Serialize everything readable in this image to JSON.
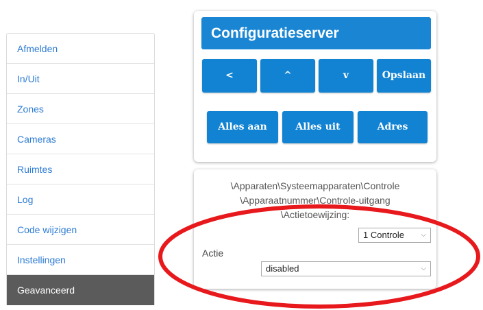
{
  "sidebar": {
    "items": [
      {
        "label": "Afmelden"
      },
      {
        "label": "In/Uit"
      },
      {
        "label": "Zones"
      },
      {
        "label": "Cameras"
      },
      {
        "label": "Ruimtes"
      },
      {
        "label": "Log"
      },
      {
        "label": "Code wijzigen"
      },
      {
        "label": "Instellingen"
      },
      {
        "label": "Geavanceerd"
      }
    ]
  },
  "header": {
    "title": "Configuratieserver"
  },
  "nav_buttons": {
    "back": "<",
    "up": "^",
    "down": "v",
    "save": "Opslaan"
  },
  "action_buttons": {
    "all_on": "Alles aan",
    "all_off": "Alles uit",
    "address": "Adres"
  },
  "config": {
    "path_line1": "\\Apparaten\\Systeemapparaten\\Controle",
    "path_line2": "\\Apparaatnummer\\Controle-uitgang",
    "path_line3": "\\Actietoewijzing:",
    "control_select": "1 Controle",
    "action_label": "Actie",
    "action_select": "disabled"
  },
  "colors": {
    "button_blue": "#1283d2",
    "link_blue": "#2c7bd3",
    "active_item": "#5b5b5b",
    "annotation_red": "#e8191c"
  }
}
